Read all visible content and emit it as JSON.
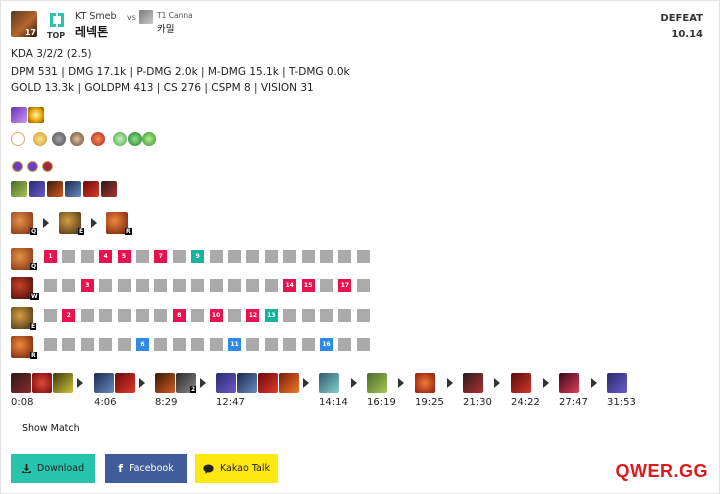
{
  "header": {
    "champion_level": "17",
    "player_team": "KT Smeb",
    "player_name": "레넥톤",
    "role": "TOP",
    "vs": "vs",
    "opponent_team": "T1 Canna",
    "opponent_name": "카밀",
    "result": "DEFEAT",
    "patch": "10.14"
  },
  "stats": {
    "line1": "KDA 3/2/2 (2.5)",
    "line2": "DPM 531 | DMG 17.1k | P-DMG 2.0k | M-DMG 15.1k | T-DMG 0.0k",
    "line3": "GOLD 13.3k | GOLDPM 413 | CS 276 | CSPM 8 | VISION 31"
  },
  "skill_order": {
    "first": "Q",
    "second": "E",
    "third": "R",
    "rows": [
      {
        "key": "Q",
        "levels": [
          "1",
          "4",
          "5",
          "7",
          "9"
        ]
      },
      {
        "key": "W",
        "levels": [
          "3",
          "14",
          "15",
          "17"
        ]
      },
      {
        "key": "E",
        "levels": [
          "2",
          "8",
          "10",
          "12",
          "13"
        ]
      },
      {
        "key": "R",
        "levels": [
          "6",
          "11",
          "16"
        ]
      }
    ]
  },
  "build_stack_counts": [
    "2"
  ],
  "item_timeline": [
    "0:08",
    "4:06",
    "8:29",
    "12:47",
    "14:14",
    "16:19",
    "19:25",
    "21:30",
    "24:22",
    "27:47",
    "31:53"
  ],
  "footer": {
    "show_match": "Show Match",
    "download": "Download",
    "facebook": "Facebook",
    "kakao": "Kakao Talk",
    "brand": "QWER.GG"
  },
  "colors": {
    "level_up": "#e8124f",
    "level_mid": "#13b39d",
    "level_ult": "#2e8ae6",
    "empty": "#aaaaaa",
    "download_btn": "#26c4ad",
    "facebook_btn": "#3f5c9b",
    "kakao_btn": "#ffe812",
    "brand": "#e0181b"
  }
}
